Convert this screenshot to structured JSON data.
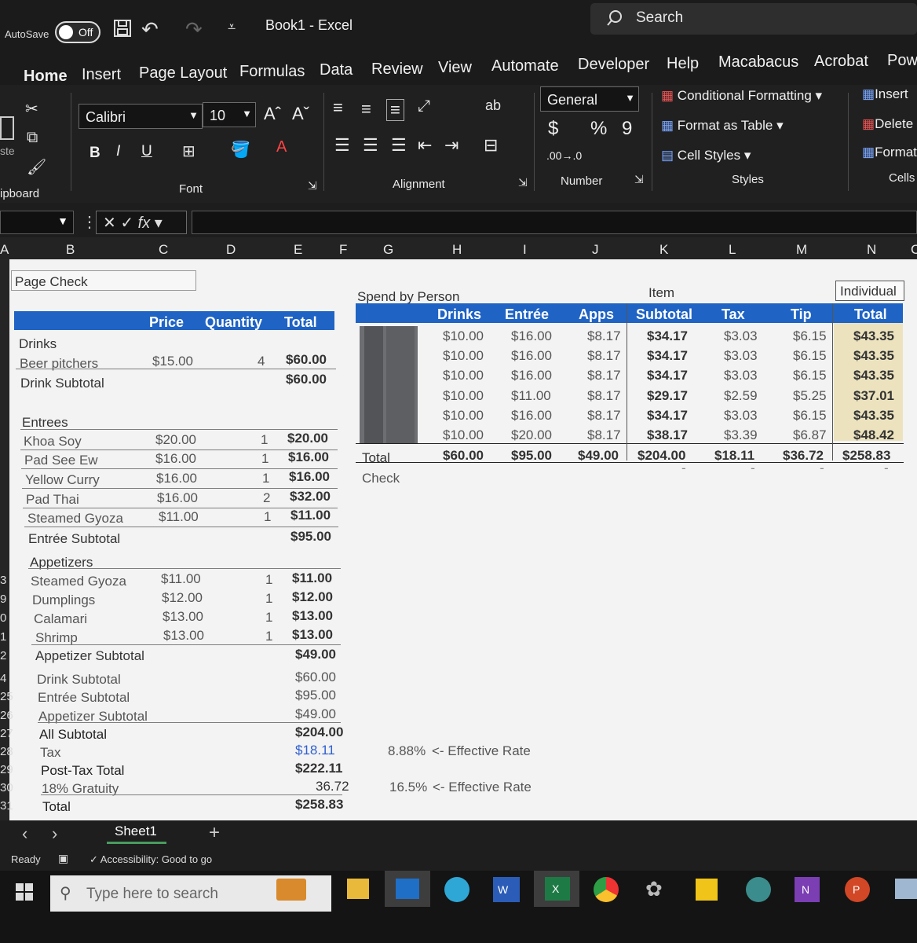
{
  "titlebar": {
    "autosave_label": "AutoSave",
    "toggle_state": "Off",
    "doc_title": "Book1  -  Excel",
    "search": "Search"
  },
  "tabs": [
    "Home",
    "Insert",
    "Page Layout",
    "Formulas",
    "Data",
    "Review",
    "View",
    "Automate",
    "Developer",
    "Help",
    "Macabacus",
    "Acrobat",
    "Pow"
  ],
  "ribbon": {
    "paste": "ste",
    "clipboard": "ipboard",
    "font_name": "Calibri",
    "font_size": "10",
    "bold": "B",
    "italic": "I",
    "underline": "U",
    "grow": "Aˆ",
    "shrink": "Aˇ",
    "font": "Font",
    "alignment": "Alignment",
    "number_format": "General",
    "currency": "$",
    "percent": "%",
    "comma": "9",
    "inc_dec": ".00→.0",
    "number": "Number",
    "cond_format": "Conditional Formatting",
    "format_table": "Format as Table",
    "cell_styles": "Cell Styles",
    "styles": "Styles",
    "insert": "Insert",
    "delete": "Delete",
    "format": "Format",
    "cells": "Cells"
  },
  "formula_bar": {
    "fx": "fx",
    "value": ""
  },
  "columns": [
    "A",
    "B",
    "C",
    "D",
    "E",
    "F",
    "G",
    "H",
    "I",
    "J",
    "K",
    "L",
    "M",
    "N",
    "C"
  ],
  "rows": [
    "3",
    "9",
    "0",
    "1",
    "2",
    "4",
    "25",
    "26",
    "27",
    "28",
    "29",
    "30",
    "31"
  ],
  "sheet": {
    "page_check": "Page Check",
    "left_header": {
      "price": "Price",
      "quantity": "Quantity",
      "total": "Total"
    },
    "drinks": {
      "title": "Drinks",
      "item": "Beer pitchers",
      "price": "$15.00",
      "qty": "4",
      "total": "$60.00",
      "subtotal_label": "Drink Subtotal",
      "subtotal": "$60.00"
    },
    "entrees": {
      "title": "Entrees",
      "items": [
        {
          "name": "Khoa Soy",
          "price": "$20.00",
          "qty": "1",
          "total": "$20.00"
        },
        {
          "name": "Pad See Ew",
          "price": "$16.00",
          "qty": "1",
          "total": "$16.00"
        },
        {
          "name": "Yellow Curry",
          "price": "$16.00",
          "qty": "1",
          "total": "$16.00"
        },
        {
          "name": "Pad Thai",
          "price": "$16.00",
          "qty": "2",
          "total": "$32.00"
        },
        {
          "name": "Steamed Gyoza",
          "price": "$11.00",
          "qty": "1",
          "total": "$11.00"
        }
      ],
      "subtotal_label": "Entrée Subtotal",
      "subtotal": "$95.00"
    },
    "apps": {
      "title": "Appetizers",
      "items": [
        {
          "name": "Steamed Gyoza",
          "price": "$11.00",
          "qty": "1",
          "total": "$11.00"
        },
        {
          "name": "Dumplings",
          "price": "$12.00",
          "qty": "1",
          "total": "$12.00"
        },
        {
          "name": "Calamari",
          "price": "$13.00",
          "qty": "1",
          "total": "$13.00"
        },
        {
          "name": "Shrimp",
          "price": "$13.00",
          "qty": "1",
          "total": "$13.00"
        }
      ],
      "subtotal_label": "Appetizer Subtotal",
      "subtotal": "$49.00"
    },
    "summary": [
      {
        "label": "Drink Subtotal",
        "value": "$60.00"
      },
      {
        "label": "Entrée Subtotal",
        "value": "$95.00"
      },
      {
        "label": "Appetizer Subtotal",
        "value": "$49.00"
      },
      {
        "label": "All Subtotal",
        "value": "$204.00"
      },
      {
        "label": "Tax",
        "value": "$18.11"
      },
      {
        "label": "Post-Tax Total",
        "value": "$222.11"
      },
      {
        "label": "18% Gratuity",
        "value": "36.72"
      },
      {
        "label": "Total",
        "value": "$258.83"
      }
    ],
    "tax_rate": {
      "value": "8.88%",
      "note": "<- Effective Rate"
    },
    "grat_rate": {
      "value": "16.5%",
      "note": "<- Effective Rate"
    },
    "spend": {
      "title": "Spend by Person",
      "item_label": "Item",
      "individual_label": "Individual",
      "headers": [
        "Drinks",
        "Entrée",
        "Apps",
        "Subtotal",
        "Tax",
        "Tip",
        "Total"
      ],
      "rows": [
        [
          "$10.00",
          "$16.00",
          "$8.17",
          "$34.17",
          "$3.03",
          "$6.15",
          "$43.35"
        ],
        [
          "$10.00",
          "$16.00",
          "$8.17",
          "$34.17",
          "$3.03",
          "$6.15",
          "$43.35"
        ],
        [
          "$10.00",
          "$16.00",
          "$8.17",
          "$34.17",
          "$3.03",
          "$6.15",
          "$43.35"
        ],
        [
          "$10.00",
          "$11.00",
          "$8.17",
          "$29.17",
          "$2.59",
          "$5.25",
          "$37.01"
        ],
        [
          "$10.00",
          "$16.00",
          "$8.17",
          "$34.17",
          "$3.03",
          "$6.15",
          "$43.35"
        ],
        [
          "$10.00",
          "$20.00",
          "$8.17",
          "$38.17",
          "$3.39",
          "$6.87",
          "$48.42"
        ]
      ],
      "total_label": "Total",
      "totals": [
        "$60.00",
        "$95.00",
        "$49.00",
        "$204.00",
        "$18.11",
        "$36.72",
        "$258.83"
      ],
      "check_label": "Check",
      "check_marks": [
        "-",
        "-",
        "-",
        "-"
      ]
    }
  },
  "sheettabs": {
    "sheet": "Sheet1",
    "add": "+"
  },
  "status": {
    "ready": "Ready",
    "accessibility": "Accessibility: Good to go"
  },
  "taskbar": {
    "search": "Type here to search"
  },
  "colors": {
    "accent_green": "#4a9b5f",
    "header_blue": "#1f63c4",
    "total_tan": "#ece3be",
    "blue_text": "#2f5fd0"
  }
}
